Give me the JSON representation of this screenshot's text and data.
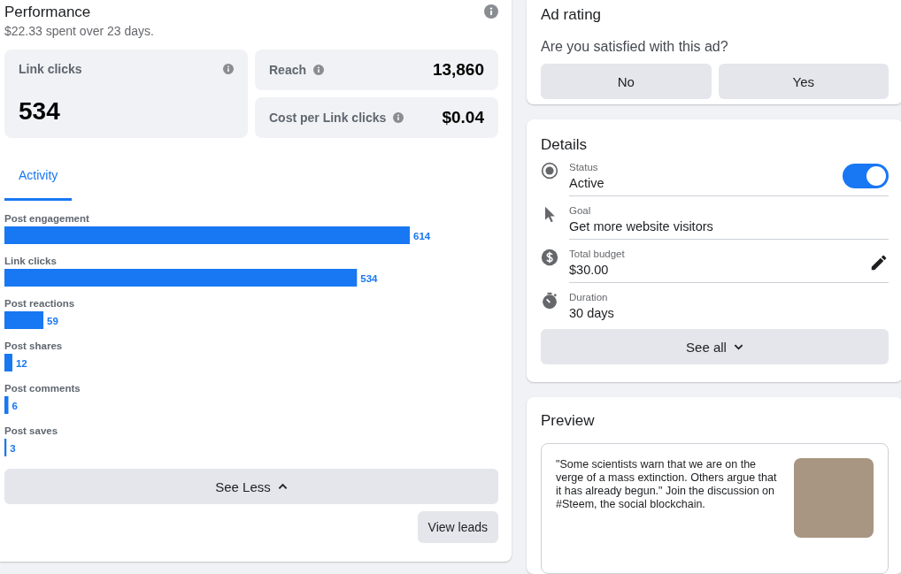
{
  "performance": {
    "title": "Performance",
    "summary": "$22.33 spent over 23 days.",
    "metrics": [
      {
        "kind": "large",
        "label": "Link clicks",
        "value": "534"
      },
      {
        "kind": "row",
        "label": "Reach",
        "value": "13,860"
      },
      {
        "kind": "row",
        "label": "Cost per Link clicks",
        "value": "$0.04"
      }
    ],
    "tabs": [
      {
        "label": "Activity",
        "selected": true
      }
    ],
    "chart_data": {
      "type": "bar",
      "orientation": "horizontal",
      "categories": [
        "Post engagement",
        "Link clicks",
        "Post reactions",
        "Post shares",
        "Post comments",
        "Post saves"
      ],
      "series": [
        {
          "color": "#1877f2",
          "values": [
            614,
            534,
            59,
            12,
            6,
            3
          ]
        }
      ],
      "data_labels": true
    },
    "see_less": "See Less",
    "view_leads": "View leads"
  },
  "ad_rating": {
    "title": "Ad rating",
    "question": "Are you satisfied with this ad?",
    "buttons": [
      "No",
      "Yes"
    ]
  },
  "details": {
    "title": "Details",
    "items": [
      {
        "kind": "status",
        "label": "Status",
        "value": "Active",
        "on": true
      },
      {
        "kind": "goal",
        "label": "Goal",
        "value": "Get more website visitors"
      },
      {
        "kind": "budget",
        "label": "Total budget",
        "value": "$30.00",
        "editable": true
      },
      {
        "kind": "duration",
        "label": "Duration",
        "value": "30 days"
      }
    ],
    "see_all": "See all"
  },
  "preview": {
    "title": "Preview",
    "text": "\"Some scientists warn that we are on the verge of a mass extinction. Others argue that it has already begun.\" Join the discussion on #Steem, the social blockchain."
  }
}
